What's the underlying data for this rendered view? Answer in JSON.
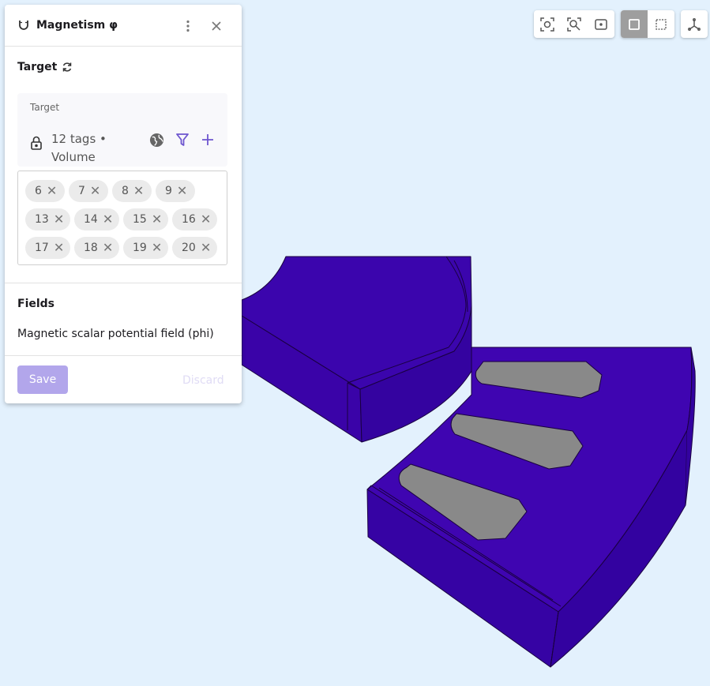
{
  "panel": {
    "title": "Magnetism φ",
    "target_section_title": "Target",
    "target_label": "Target",
    "tags_summary_line1": "12 tags •",
    "tags_summary_line2": "Volume",
    "tags": [
      "6",
      "7",
      "8",
      "9",
      "13",
      "14",
      "15",
      "16",
      "17",
      "18",
      "19",
      "20"
    ],
    "fields_title": "Fields",
    "field_name": "Magnetic scalar potential field (phi)",
    "save_label": "Save",
    "discard_label": "Discard"
  },
  "icons": {
    "header": "magnet-icon",
    "refresh": "refresh-icon",
    "lock": "lock-icon",
    "globe": "globe-icon",
    "filter": "filter-icon",
    "add": "plus-icon",
    "menu": "more-vert-icon",
    "close": "close-icon"
  },
  "toolbar": {
    "buttons": [
      "zoom-to-selection-icon",
      "zoom-fit-icon",
      "frame-icon",
      "solid-view-icon",
      "wireframe-view-icon",
      "axes-icon"
    ],
    "active": "solid-view-icon"
  },
  "colors": {
    "background": "#e3f1fd",
    "solid": "#3f05b1",
    "magnet_slot": "#898989",
    "accent": "#6e56cf"
  }
}
